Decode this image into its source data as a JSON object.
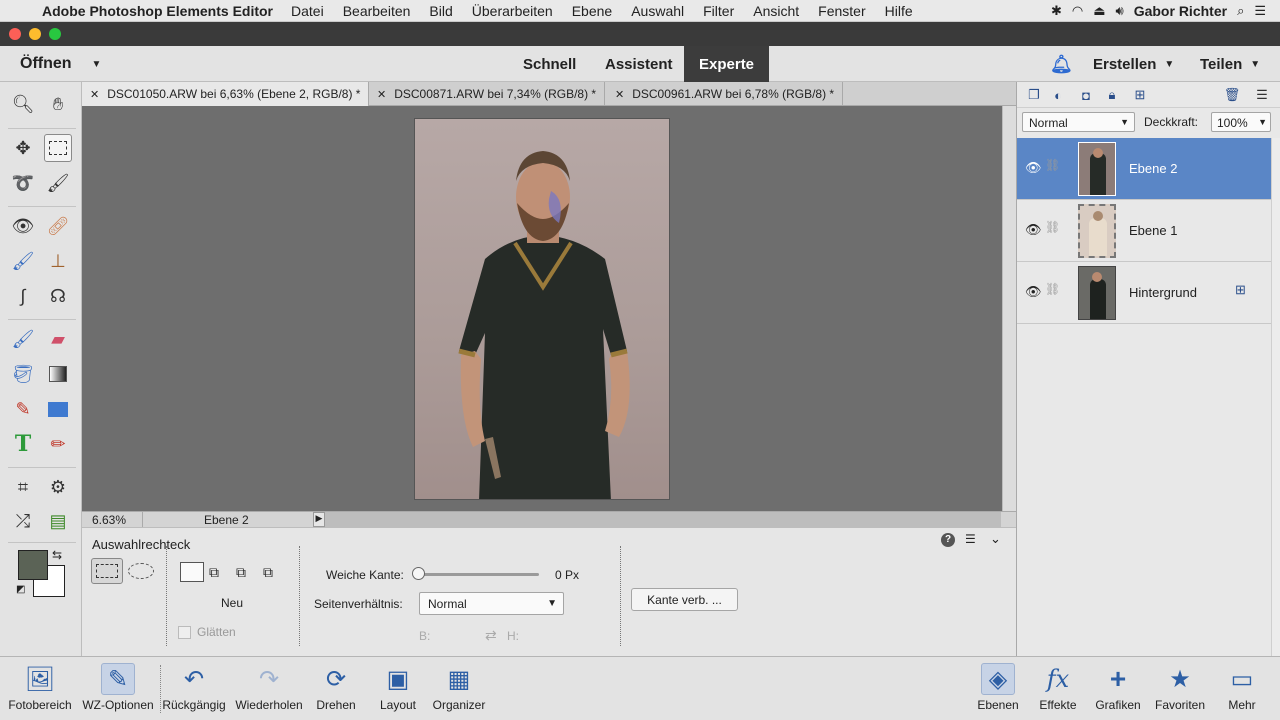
{
  "menubar": {
    "apple": "",
    "app_name": "Adobe Photoshop Elements Editor",
    "items": [
      "Datei",
      "Bearbeiten",
      "Bild",
      "Überarbeiten",
      "Ebene",
      "Auswahl",
      "Filter",
      "Ansicht",
      "Fenster",
      "Hilfe"
    ],
    "user": "Gabor Richter"
  },
  "modebar": {
    "open_label": "Öffnen",
    "modes": [
      "Schnell",
      "Assistent",
      "Experte"
    ],
    "active_mode": "Experte",
    "create_label": "Erstellen",
    "share_label": "Teilen"
  },
  "tabs": [
    {
      "label": "DSC01050.ARW bei 6,63% (Ebene 2, RGB/8) *",
      "active": true
    },
    {
      "label": "DSC00871.ARW bei 7,34% (RGB/8) *",
      "active": false
    },
    {
      "label": "DSC00961.ARW bei 6,78% (RGB/8) *",
      "active": false
    }
  ],
  "status": {
    "zoom": "6.63%",
    "layer": "Ebene 2"
  },
  "options": {
    "tool_name": "Auswahlrechteck",
    "new_label": "Neu",
    "smooth_label": "Glätten",
    "feather_label": "Weiche Kante:",
    "feather_value": "0 Px",
    "feather_fraction": 0,
    "aspect_label": "Seitenverhältnis:",
    "aspect_value": "Normal",
    "width_label": "B:",
    "height_label": "H:",
    "refine_edge_label": "Kante verb. ..."
  },
  "layers_panel": {
    "blend_mode": "Normal",
    "opacity_label": "Deckkraft:",
    "opacity_value": "100%",
    "layers": [
      {
        "name": "Ebene 2",
        "selected": true
      },
      {
        "name": "Ebene 1",
        "selected": false
      },
      {
        "name": "Hintergrund",
        "selected": false
      }
    ]
  },
  "bottombar": {
    "left": [
      "Fotobereich",
      "WZ-Optionen",
      "Rückgängig",
      "Wiederholen",
      "Drehen",
      "Layout",
      "Organizer"
    ],
    "right": [
      "Ebenen",
      "Effekte",
      "Grafiken",
      "Favoriten",
      "Mehr"
    ]
  },
  "colors": {
    "foreground": "#5b6356",
    "background": "#ffffff",
    "selection": "#5a86c6",
    "accent_icon": "#2d5fa5"
  }
}
